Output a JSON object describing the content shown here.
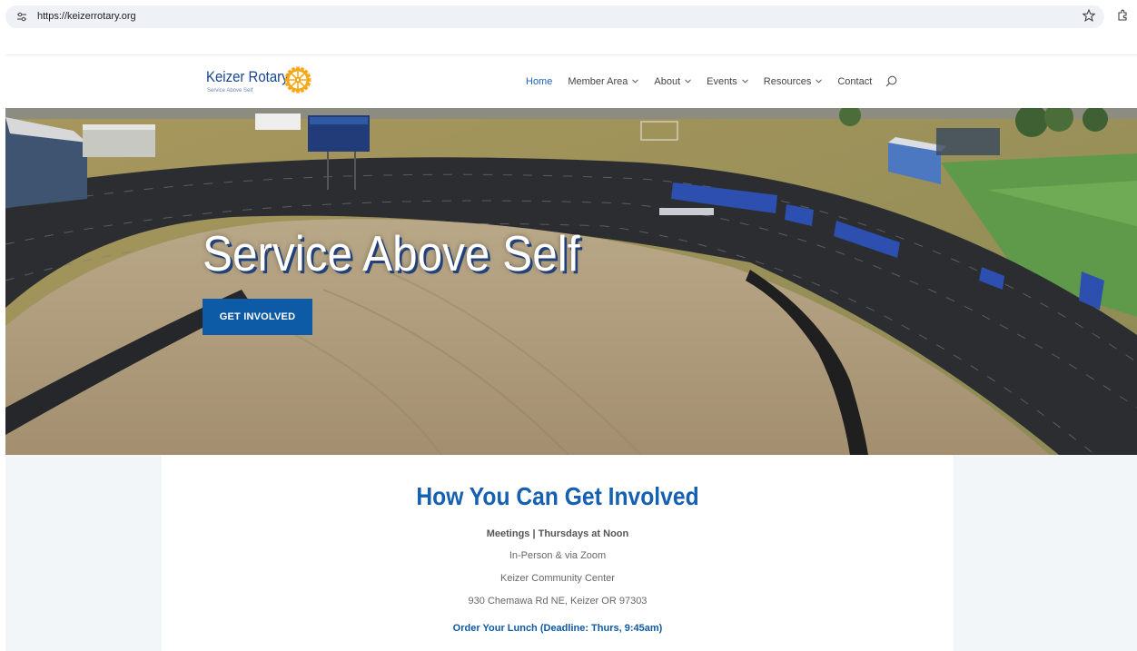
{
  "browser": {
    "url": "https://keizerrotary.org"
  },
  "header": {
    "logo_title": "Keizer Rotary",
    "logo_tagline": "Service Above Self",
    "nav": [
      {
        "label": "Home"
      },
      {
        "label": "Member Area"
      },
      {
        "label": "About"
      },
      {
        "label": "Events"
      },
      {
        "label": "Resources"
      },
      {
        "label": "Contact"
      }
    ]
  },
  "hero": {
    "heading": "Service Above Self",
    "cta_label": "GET INVOLVED"
  },
  "involved": {
    "title": "How You Can Get Involved",
    "meetings": "Meetings | Thursdays at Noon",
    "format": "In-Person & via Zoom",
    "venue": "Keizer Community Center",
    "address": "930 Chemawa Rd NE, Keizer OR 97303",
    "lunch_link": "Order Your Lunch (Deadline: Thurs, 9:45am)"
  },
  "colors": {
    "brand_blue": "#17458f",
    "link_blue": "#1a64b8",
    "cta_blue": "#0d5aa7",
    "rotary_gold": "#f7a81b"
  },
  "icons": [
    "site-info-icon",
    "bookmark-star-icon",
    "extensions-icon",
    "rotary-wheel-icon",
    "chevron-down-icon",
    "search-icon"
  ]
}
